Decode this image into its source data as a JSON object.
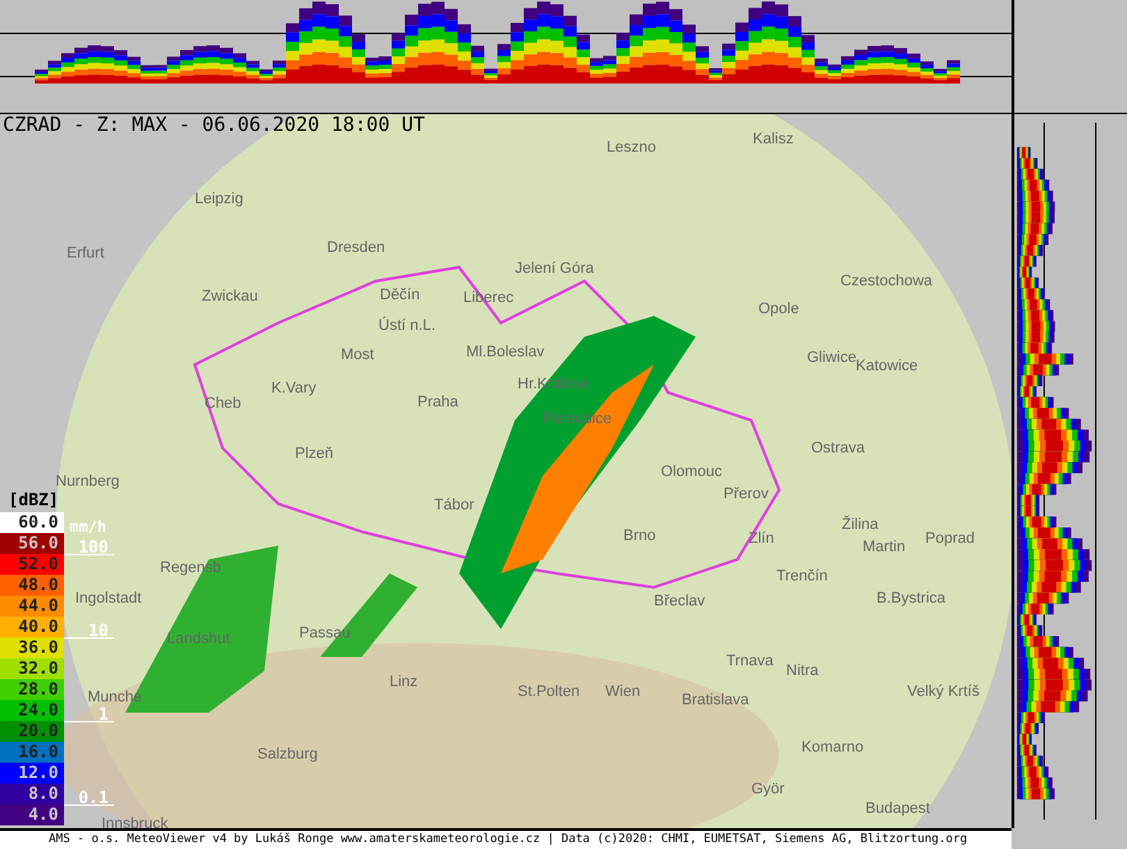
{
  "title": "CZRAD - Z: MAX - 06.06.2020 18:00 UT",
  "cities": [
    {
      "name": "Leszno"
    },
    {
      "name": "Kalisz"
    },
    {
      "name": "Leipzig"
    },
    {
      "name": "Erfurt"
    },
    {
      "name": "Dresden"
    },
    {
      "name": "Zwickau"
    },
    {
      "name": "Jelení Góra"
    },
    {
      "name": "Czestochowa"
    },
    {
      "name": "Opole"
    },
    {
      "name": "Děčín"
    },
    {
      "name": "Liberec"
    },
    {
      "name": "Ústí n.L."
    },
    {
      "name": "Most"
    },
    {
      "name": "Ml.Boleslav"
    },
    {
      "name": "Hr.Králové"
    },
    {
      "name": "Gliwice"
    },
    {
      "name": "Katowice"
    },
    {
      "name": "Cheb"
    },
    {
      "name": "K.Vary"
    },
    {
      "name": "Pardubice"
    },
    {
      "name": "Praha"
    },
    {
      "name": "Ostrava"
    },
    {
      "name": "Plzeň"
    },
    {
      "name": "Olomouc"
    },
    {
      "name": "Přerov"
    },
    {
      "name": "Tábor"
    },
    {
      "name": "Brno"
    },
    {
      "name": "Zlín"
    },
    {
      "name": "Žilina"
    },
    {
      "name": "Martin"
    },
    {
      "name": "Poprad"
    },
    {
      "name": "Nurnberg"
    },
    {
      "name": "Regensb"
    },
    {
      "name": "Ingolstadt"
    },
    {
      "name": "Trenčín"
    },
    {
      "name": "B.Bystrica"
    },
    {
      "name": "Landshut"
    },
    {
      "name": "Passau"
    },
    {
      "name": "Břeclav"
    },
    {
      "name": "Trnava"
    },
    {
      "name": "Nitra"
    },
    {
      "name": "Munche"
    },
    {
      "name": "Linz"
    },
    {
      "name": "St.Polten"
    },
    {
      "name": "Wien"
    },
    {
      "name": "Bratislava"
    },
    {
      "name": "Velký Krtíš"
    },
    {
      "name": "Salzburg"
    },
    {
      "name": "Komarno"
    },
    {
      "name": "Györ"
    },
    {
      "name": "Budapest"
    },
    {
      "name": "Innsbruck"
    }
  ],
  "legend": {
    "unit": "[dBZ]",
    "rate_unit": "mm/h",
    "steps": [
      {
        "label": "60.0",
        "color": "#ffffff"
      },
      {
        "label": "56.0",
        "color": "#a00000"
      },
      {
        "label": "52.0",
        "color": "#ff0000"
      },
      {
        "label": "48.0",
        "color": "#ff6000"
      },
      {
        "label": "44.0",
        "color": "#ff8c00"
      },
      {
        "label": "40.0",
        "color": "#ffb000"
      },
      {
        "label": "36.0",
        "color": "#e0e000"
      },
      {
        "label": "32.0",
        "color": "#a0e000"
      },
      {
        "label": "28.0",
        "color": "#40d000"
      },
      {
        "label": "24.0",
        "color": "#00c000"
      },
      {
        "label": "20.0",
        "color": "#009000"
      },
      {
        "label": "16.0",
        "color": "#0070c0"
      },
      {
        "label": "12.0",
        "color": "#0000ff"
      },
      {
        "label": "8.0",
        "color": "#3000a0"
      },
      {
        "label": "4.0",
        "color": "#400080"
      }
    ],
    "rates": [
      {
        "label": "100"
      },
      {
        "label": "10"
      },
      {
        "label": "1"
      },
      {
        "label": "0.1"
      }
    ]
  },
  "footer": "AMS - o.s. MeteoViewer v4 by Lukáš Ronge www.amaterskameteorologie.cz | Data (c)2020: CHMI, EUMETSAT, Siemens AG, Blitzortung.org"
}
